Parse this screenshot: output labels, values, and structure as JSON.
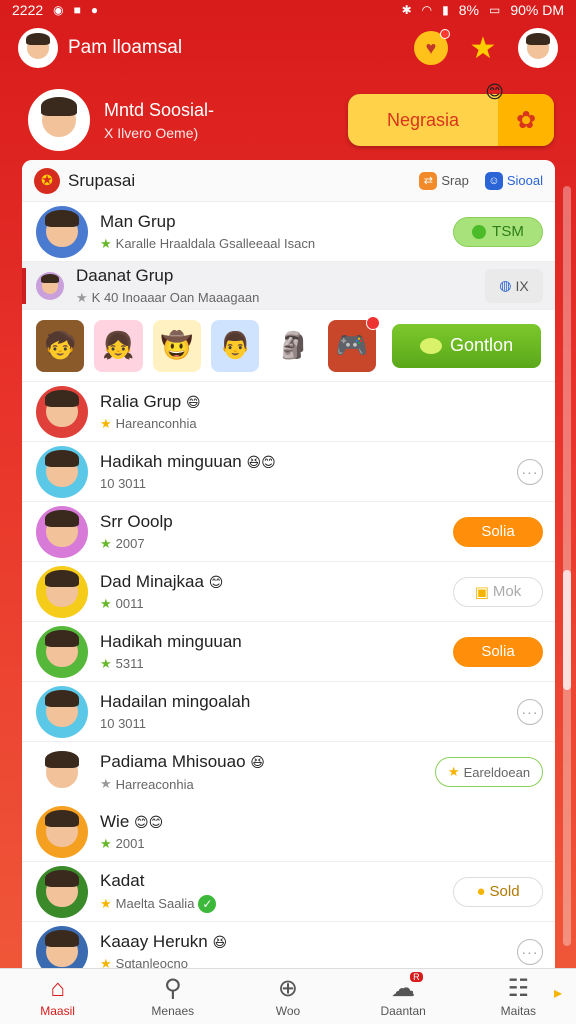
{
  "status_bar": {
    "time": "2222",
    "battery_text": "8%",
    "clock_right": "90% DM"
  },
  "header": {
    "title": "Pam lloamsal",
    "icons": [
      "user-avatar",
      "heart-icon",
      "star-icon",
      "profile-avatar"
    ]
  },
  "profile": {
    "name": "Mntd Soosial-",
    "subtitle": "X Ilvero Oeme)",
    "cta_label": "Negrasia",
    "cta_icon": "gear-icon"
  },
  "card": {
    "title": "Srupasai",
    "link_grey": "Srap",
    "link_blue": "Siooal"
  },
  "rows_top": [
    {
      "title": "Man Grup",
      "subtitle": "Karalle Hraaldala Gsalleeaal Isacn",
      "action": "TSM"
    },
    {
      "title": "Daanat Grup",
      "subtitle": "K 40 Inoaaar Oan  Maaagaan",
      "action": "IX"
    }
  ],
  "contact_button": "Gontlon",
  "contacts": [
    {
      "title": "Ralia Grup",
      "subtitle": "Hareanconhia",
      "action": "",
      "star": "yellow",
      "emoji": "😄"
    },
    {
      "title": "Hadikah minguuan",
      "subtitle": "10 3011",
      "action": "more",
      "star": "",
      "emoji": "😆😊"
    },
    {
      "title": "Srr Ooolp",
      "subtitle": "2007",
      "action": "Solia",
      "star": "green",
      "emoji": ""
    },
    {
      "title": "Dad Minajkaa",
      "subtitle": "0011",
      "action": "Mok",
      "star": "green",
      "emoji": "😊"
    },
    {
      "title": "Hadikah minguuan",
      "subtitle": "5311",
      "action": "Solia",
      "star": "green",
      "emoji": ""
    },
    {
      "title": "Hadailan mingoalah",
      "subtitle": "10 3011",
      "action": "more",
      "star": "",
      "emoji": ""
    },
    {
      "title": "Padiama Mhisouao",
      "subtitle": "Harreaconhia",
      "action": "Eareldoean",
      "star": "grey",
      "emoji": "😆"
    },
    {
      "title": "Wie",
      "subtitle": "2001",
      "action": "",
      "star": "green",
      "emoji": "😊😊"
    },
    {
      "title": "Kadat",
      "subtitle": "Maelta Saalia",
      "action": "Sold",
      "star": "yellow",
      "emoji": ""
    },
    {
      "title": "Kaaay Herukn",
      "subtitle": "Sqtanleocno",
      "action": "more",
      "star": "yellow",
      "emoji": "😆"
    }
  ],
  "bottom_nav": [
    {
      "label": "Maasil",
      "icon": "home-icon",
      "active": true
    },
    {
      "label": "Menaes",
      "icon": "search-icon",
      "active": false
    },
    {
      "label": "Woo",
      "icon": "plus-circle-icon",
      "active": false
    },
    {
      "label": "Daantan",
      "icon": "chat-icon",
      "active": false,
      "badge": "R"
    },
    {
      "label": "Maitas",
      "icon": "grid-icon",
      "active": false
    }
  ]
}
